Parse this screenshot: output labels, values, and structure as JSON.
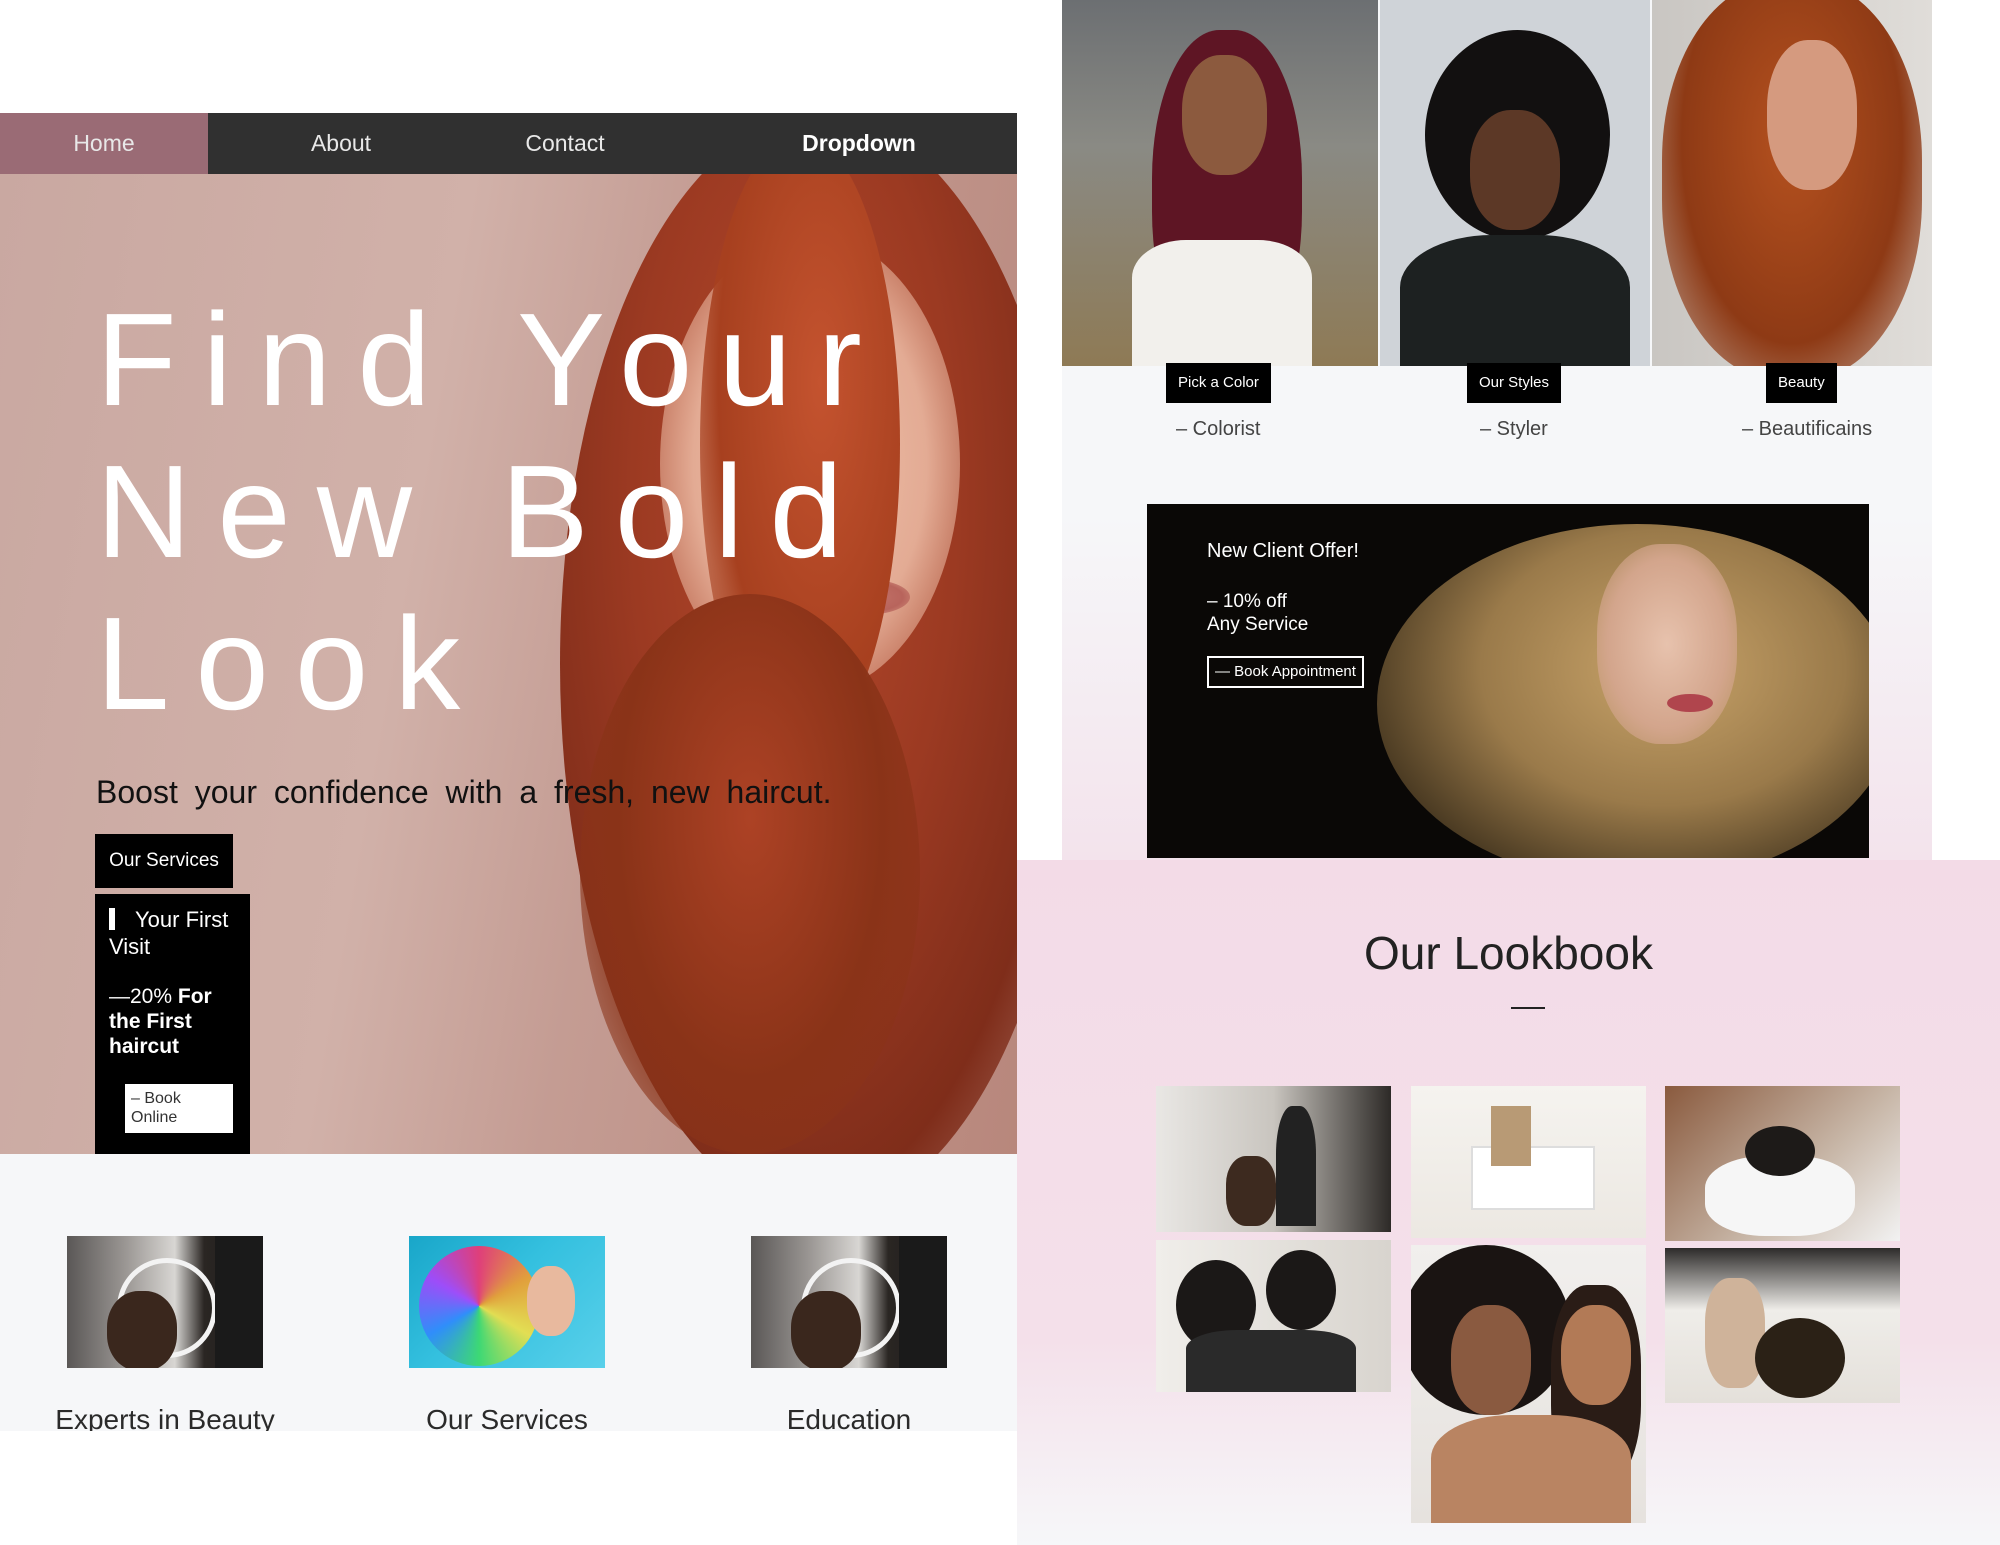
{
  "nav": {
    "items": [
      "Home",
      "About",
      "Contact",
      "Dropdown"
    ]
  },
  "hero": {
    "title_line1": "Find Your",
    "title_line2": "New Bold",
    "title_line3": "Look",
    "subtitle": "Boost your confidence with a fresh, new haircut.",
    "services_button": "Our Services",
    "visit": {
      "title": "Your First Visit",
      "offer_prefix": "—20%",
      "offer_rest": " For the First haircut",
      "book_button": "– Book Online"
    }
  },
  "features": [
    {
      "caption": "Experts in Beauty"
    },
    {
      "caption": "Our Services"
    },
    {
      "caption": "Education"
    }
  ],
  "stylists": [
    {
      "tag": "Pick a Color",
      "role": "– Colorist"
    },
    {
      "tag": "Our Styles",
      "role": "– Styler"
    },
    {
      "tag": "Beauty",
      "role": "– Beautificains"
    }
  ],
  "offer": {
    "title": "New Client Offer!",
    "line1": "– 10% off",
    "line2": "Any Service",
    "button": "— Book Appointment"
  },
  "lookbook": {
    "title": "Our Lookbook"
  },
  "colors": {
    "nav_bg": "#303030",
    "nav_active": "#9a6b75",
    "lookbook_bg": "#f3dbe7"
  }
}
